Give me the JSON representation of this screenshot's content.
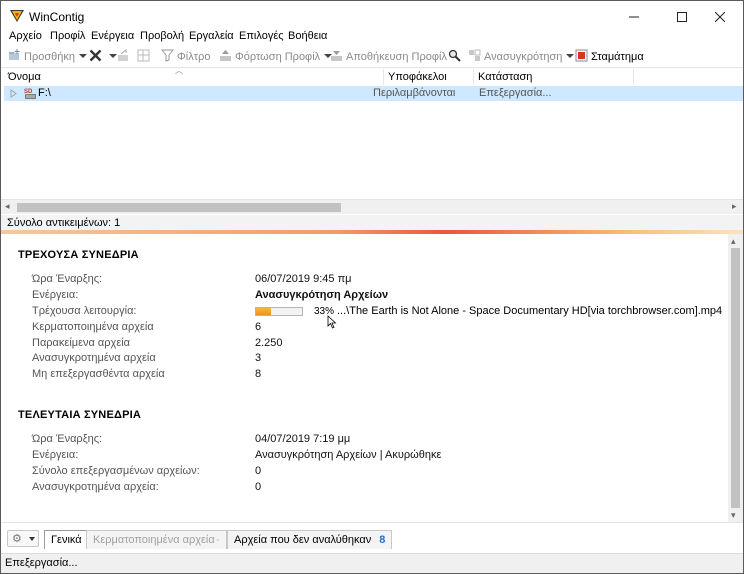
{
  "window": {
    "title": "WinContig"
  },
  "menu": [
    "Αρχείο",
    "Προφίλ",
    "Ενέργεια",
    "Προβολή",
    "Εργαλεία",
    "Επιλογές",
    "Βοήθεια"
  ],
  "toolbar": {
    "add": "Προσθήκη",
    "filter": "Φίλτρο",
    "load_profile": "Φόρτωση Προφίλ",
    "save_profile": "Αποθήκευση Προφίλ",
    "defrag": "Ανασυγκρότηση",
    "stop": "Σταμάτημα"
  },
  "columns": {
    "name": "Όνομα",
    "subfolders": "Υποφάκελοι",
    "status": "Κατάσταση"
  },
  "items": [
    {
      "name": "F:\\",
      "subfolders": "Περιλαμβάνονται",
      "status": "Επεξεργασία..."
    }
  ],
  "item_count": "Σύνολο αντικειμένων:  1",
  "current_session": {
    "title": "ΤΡΕΧΟΥΣΑ ΣΥΝΕΔΡΙΑ",
    "start_label": "Ώρα Έναρξης:",
    "start_value": "06/07/2019 9:45 πμ",
    "action_label": "Ενέργεια:",
    "action_value": "Ανασυγκρότηση Αρχείων",
    "operation_label": "Τρέχουσα λειτουργία:",
    "progress": 33,
    "progress_text": "33%",
    "current_file": "...\\The Earth is Not Alone - Space Documentary HD[via torchbrowser.com].mp4",
    "fragmented_label": "Κερματοποιημένα αρχεία",
    "fragmented_value": "6",
    "skipped_label": "Παρακείμενα αρχεία",
    "skipped_value": "2.250",
    "defragged_label": "Ανασυγκροτημένα αρχεία",
    "defragged_value": "3",
    "unprocessed_label": "Μη επεξεργασθέντα αρχεία",
    "unprocessed_value": "8"
  },
  "last_session": {
    "title": "ΤΕΛΕΥΤΑΙΑ ΣΥΝΕΔΡΙΑ",
    "start_label": "Ώρα Έναρξης:",
    "start_value": "04/07/2019 7:19 μμ",
    "action_label": "Ενέργεια:",
    "action_value": "Ανασυγκρότηση Αρχείων | Ακυρώθηκε",
    "processed_label": "Σύνολο επεξεργασμένων αρχείων:",
    "processed_value": "0",
    "defragged_label": "Ανασυγκροτημένα αρχεία:",
    "defragged_value": "0"
  },
  "tabs": {
    "general": "Γενικά",
    "fragmented": "Κερματοποιημένα αρχεία",
    "not_analyzed": "Αρχεία που δεν αναλύθηκαν",
    "not_analyzed_count": "8"
  },
  "status_text": "Επεξεργασία..."
}
